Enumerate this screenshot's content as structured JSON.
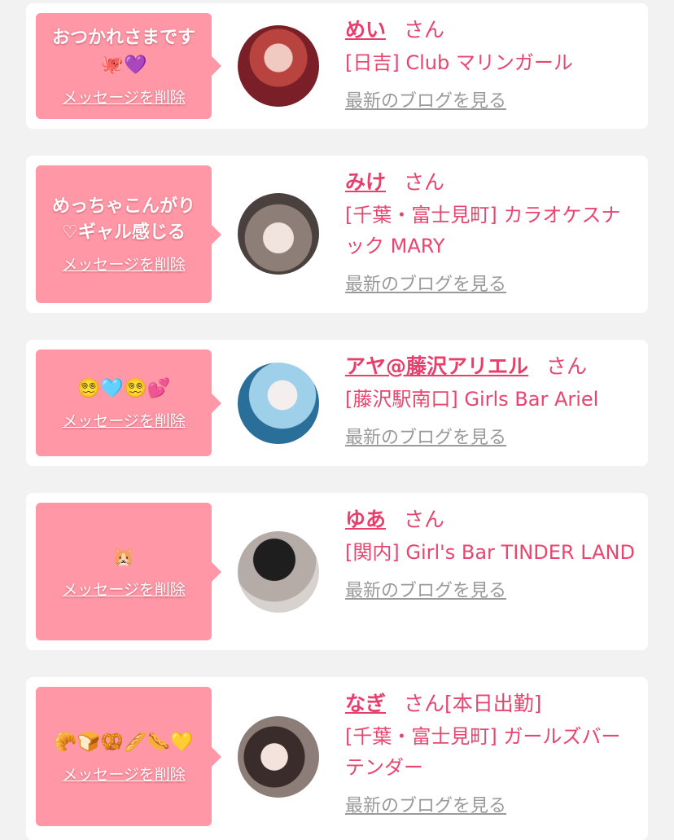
{
  "cards": [
    {
      "message": "おつかれさまです",
      "message_emoji": "🐙💜",
      "delete_label": "メッセージを削除",
      "name": "めい",
      "honorific": "さん",
      "status": "",
      "shop": "[日吉] Club マリンガール",
      "blog_link": "最新のブログを見る"
    },
    {
      "message": "めっちゃこんがり\n♡ギャル感じる",
      "message_emoji": "",
      "delete_label": "メッセージを削除",
      "name": "みけ",
      "honorific": "さん",
      "status": "",
      "shop": "[千葉・富士見町] カラオケスナック MARY",
      "blog_link": "最新のブログを見る"
    },
    {
      "message": "",
      "message_emoji": "😵‍💫🩵😵‍💫💕",
      "delete_label": "メッセージを削除",
      "name": "アヤ@藤沢アリエル",
      "honorific": "さん",
      "status": "",
      "shop": "[藤沢駅南口] Girls Bar Ariel",
      "blog_link": "最新のブログを見る"
    },
    {
      "message": "",
      "message_emoji": "🐹",
      "delete_label": "メッセージを削除",
      "name": "ゆあ",
      "honorific": "さん",
      "status": "",
      "shop": "[関内] Girl's Bar TINDER LAND",
      "blog_link": "最新のブログを見る"
    },
    {
      "message": "",
      "message_emoji": "🥐🍞🥨🥖🌭💛",
      "delete_label": "メッセージを削除",
      "name": "なぎ",
      "honorific": "さん",
      "status": "[本日出勤]",
      "shop": "[千葉・富士見町] ガールズバーテンダー",
      "blog_link": "最新のブログを見る"
    }
  ],
  "colors": {
    "bubble": "#ff97a6",
    "accent": "#e83e6c",
    "link_gray": "#9a9a9a",
    "background": "#f2f2f2"
  }
}
